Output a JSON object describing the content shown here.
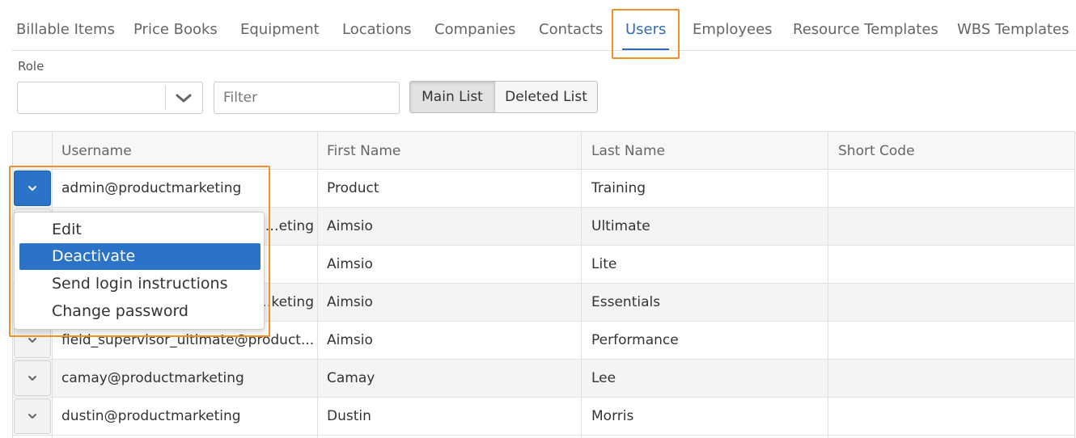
{
  "tabs": [
    {
      "label": "Billable Items",
      "active": false
    },
    {
      "label": "Price Books",
      "active": false
    },
    {
      "label": "Equipment",
      "active": false
    },
    {
      "label": "Locations",
      "active": false
    },
    {
      "label": "Companies",
      "active": false
    },
    {
      "label": "Contacts",
      "active": false
    },
    {
      "label": "Users",
      "active": true
    },
    {
      "label": "Employees",
      "active": false
    },
    {
      "label": "Resource Templates",
      "active": false
    },
    {
      "label": "WBS Templates",
      "active": false
    }
  ],
  "filters": {
    "role_label": "Role",
    "role_value": "",
    "filter_placeholder": "Filter",
    "filter_value": "",
    "main_list_label": "Main List",
    "deleted_list_label": "Deleted List",
    "selected_list": "Main List"
  },
  "grid": {
    "columns": [
      "Username",
      "First Name",
      "Last Name",
      "Short Code"
    ],
    "rows": [
      {
        "username": "admin@productmarketing",
        "first": "Product",
        "last": "Training",
        "short": ""
      },
      {
        "username": "…eting",
        "first": "Aimsio",
        "last": "Ultimate",
        "short": ""
      },
      {
        "username": "",
        "first": "Aimsio",
        "last": "Lite",
        "short": ""
      },
      {
        "username": "…keting",
        "first": "Aimsio",
        "last": "Essentials",
        "short": ""
      },
      {
        "username": "field_supervisor_ultimate@product...",
        "first": "Aimsio",
        "last": "Performance",
        "short": ""
      },
      {
        "username": "camay@productmarketing",
        "first": "Camay",
        "last": "Lee",
        "short": ""
      },
      {
        "username": "dustin@productmarketing",
        "first": "Dustin",
        "last": "Morris",
        "short": ""
      }
    ]
  },
  "row_menu": {
    "items": [
      {
        "label": "Edit",
        "selected": false
      },
      {
        "label": "Deactivate",
        "selected": true
      },
      {
        "label": "Send login instructions",
        "selected": false
      },
      {
        "label": "Change password",
        "selected": false
      }
    ]
  },
  "icons": {
    "role_dropdown": "chevron-down-icon",
    "row_action": "chevron-down-icon"
  },
  "colors": {
    "accent": "#2a73c9",
    "active_tab": "#2f6db5",
    "highlight": "#f0902a"
  }
}
